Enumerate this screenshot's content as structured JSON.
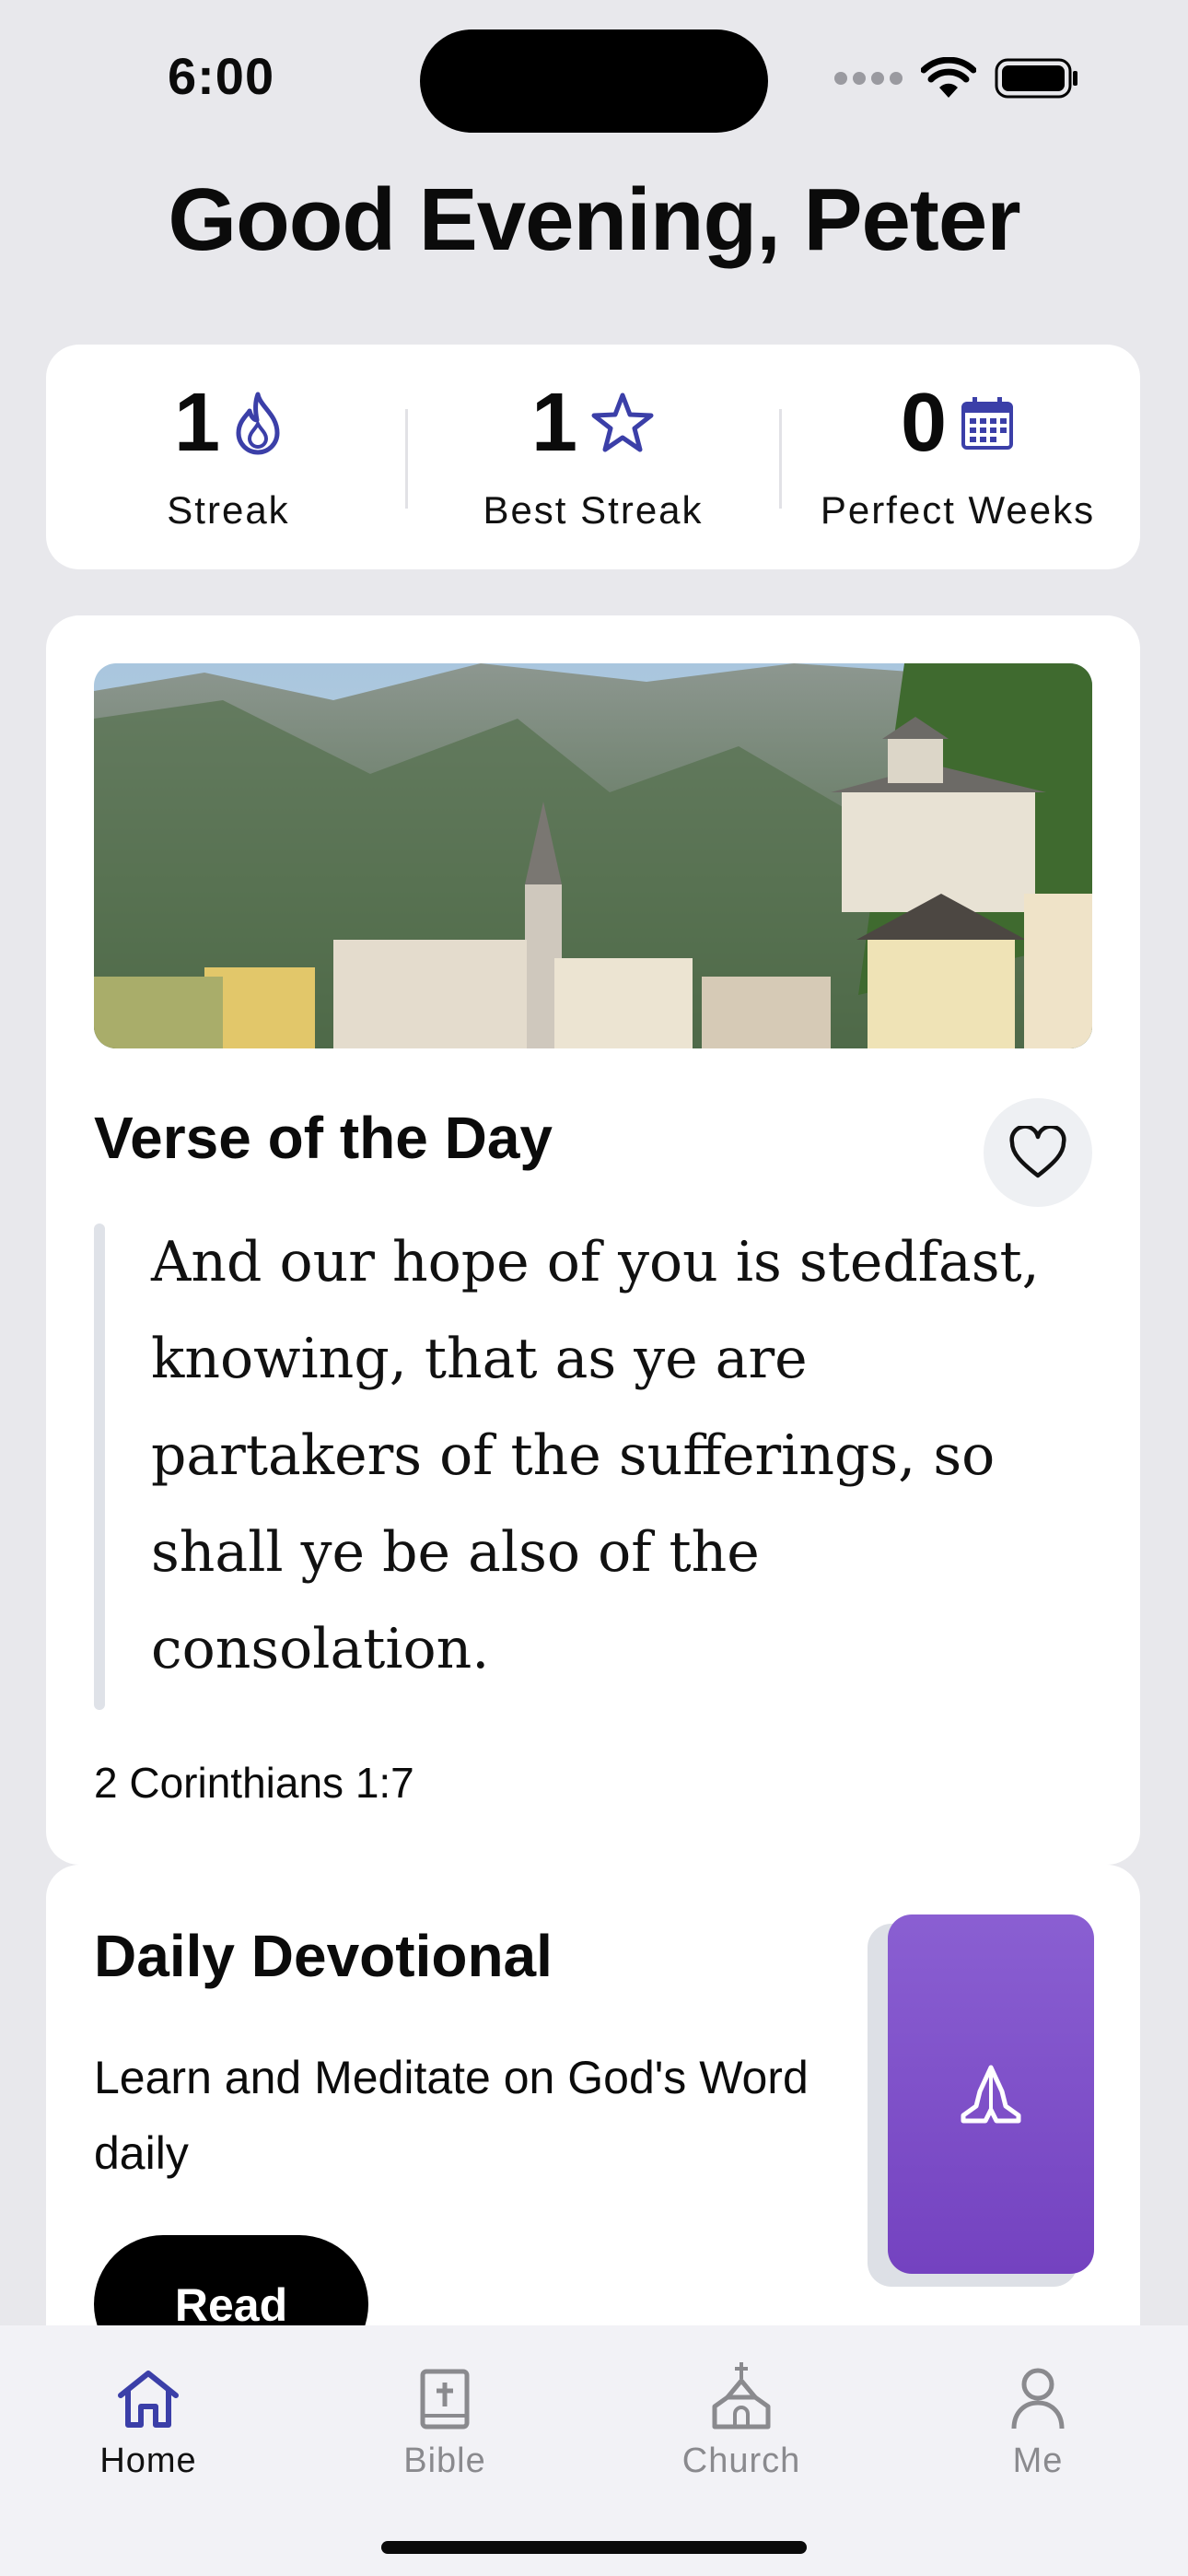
{
  "status_bar": {
    "time": "6:00"
  },
  "greeting": "Good Evening, Peter",
  "stats": [
    {
      "value": "1",
      "label": "Streak",
      "icon": "flame-icon"
    },
    {
      "value": "1",
      "label": "Best Streak",
      "icon": "star-icon"
    },
    {
      "value": "0",
      "label": "Perfect Weeks",
      "icon": "calendar-icon"
    }
  ],
  "verse": {
    "title": "Verse of the Day",
    "text": "And our hope of you is stedfast, knowing, that as ye are partakers of the sufferings, so shall ye be also of the consolation.",
    "reference": "2 Corinthians 1:7"
  },
  "devotional": {
    "title": "Daily Devotional",
    "description": "Learn and Meditate on God's Word daily",
    "button": "Read",
    "icon": "praying-hands-icon"
  },
  "tabs": [
    {
      "label": "Home",
      "icon": "home-icon",
      "active": true
    },
    {
      "label": "Bible",
      "icon": "bible-icon",
      "active": false
    },
    {
      "label": "Church",
      "icon": "church-icon",
      "active": false
    },
    {
      "label": "Me",
      "icon": "person-icon",
      "active": false
    }
  ],
  "colors": {
    "accent": "#3b3fa8",
    "devotional_card": "#7b4cc8",
    "background": "#e8e8ec"
  }
}
